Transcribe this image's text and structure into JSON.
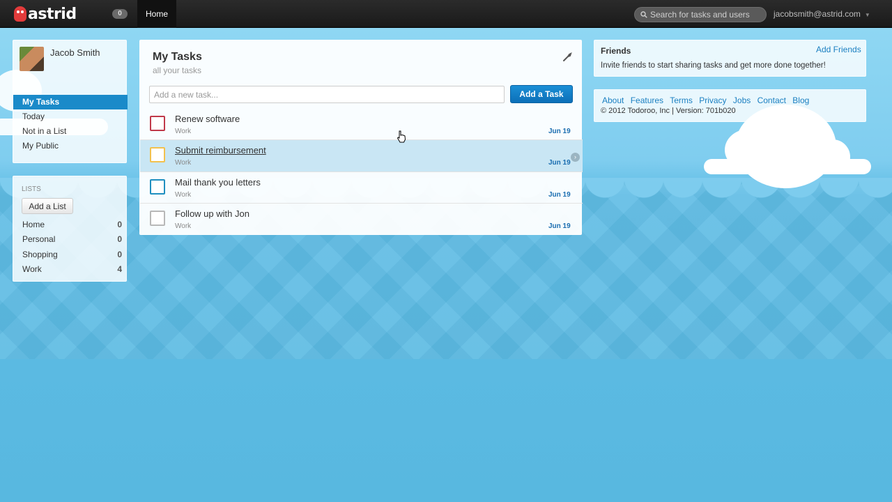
{
  "app": {
    "logo_text": "astrid",
    "notification_count": "0",
    "nav_home": "Home",
    "search_placeholder": "Search for tasks and users",
    "user_email": "jacobsmith@astrid.com"
  },
  "profile": {
    "name": "Jacob Smith"
  },
  "sidebar": {
    "items": [
      {
        "label": "My Tasks",
        "active": true
      },
      {
        "label": "Today"
      },
      {
        "label": "Not in a List"
      },
      {
        "label": "My Public"
      }
    ]
  },
  "lists": {
    "heading": "LISTS",
    "add_button": "Add a List",
    "items": [
      {
        "name": "Home",
        "count": "0"
      },
      {
        "name": "Personal",
        "count": "0"
      },
      {
        "name": "Shopping",
        "count": "0"
      },
      {
        "name": "Work",
        "count": "4"
      }
    ]
  },
  "main": {
    "title": "My Tasks",
    "subtitle": "all your tasks",
    "new_task_placeholder": "Add a new task...",
    "add_task_button": "Add a Task",
    "tasks": [
      {
        "title": "Renew software",
        "list": "Work",
        "due": "Jun 19",
        "color": "#c0394a"
      },
      {
        "title": "Submit reimbursement",
        "list": "Work",
        "due": "Jun 19",
        "color": "#f2c14e"
      },
      {
        "title": "Mail thank you letters",
        "list": "Work",
        "due": "Jun 19",
        "color": "#1f8fc0"
      },
      {
        "title": "Follow up with Jon",
        "list": "Work",
        "due": "Jun 19",
        "color": "#b8b8b8"
      }
    ]
  },
  "friends": {
    "title": "Friends",
    "add_link": "Add Friends",
    "text": "Invite friends to start sharing tasks and get more done together!"
  },
  "footer": {
    "links": [
      "About",
      "Features",
      "Terms",
      "Privacy",
      "Jobs",
      "Contact",
      "Blog"
    ],
    "copyright": "© 2012 Todoroo, Inc | Version: 701b020"
  },
  "colors": {
    "accent": "#1a8ac9",
    "topbar": "#222222",
    "sky": "#58b8e0"
  }
}
